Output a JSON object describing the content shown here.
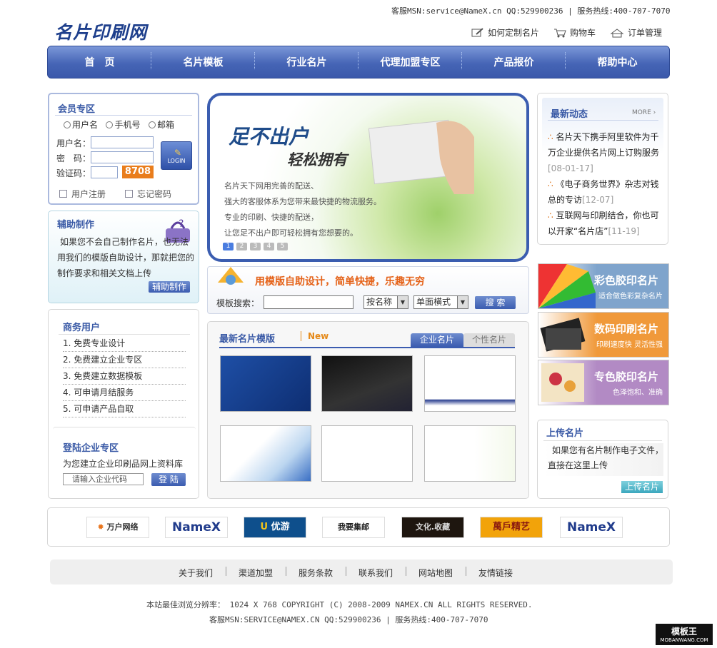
{
  "header": {
    "contact": "客服MSN:service@NameX.cn  QQ:529900236 | 服务热线:400-707-7070",
    "logo": "名片印刷网",
    "links": [
      {
        "label": "如何定制名片",
        "icon": "edit-icon"
      },
      {
        "label": "购物车",
        "icon": "cart-icon"
      },
      {
        "label": "订单管理",
        "icon": "truck-icon"
      }
    ]
  },
  "nav": [
    "首　页",
    "名片模板",
    "行业名片",
    "代理加盟专区",
    "产品报价",
    "帮助中心"
  ],
  "member": {
    "title": "会员专区",
    "radios": [
      "用户名",
      "手机号",
      "邮箱"
    ],
    "fields": [
      "用户名：",
      "密　码：",
      "验证码："
    ],
    "captcha": "8708",
    "login": "LOGIN",
    "register": "用户注册",
    "forgot": "忘记密码"
  },
  "assist": {
    "title": "辅助制作",
    "text": "如果您不会自己制作名片，也无法用我们的模版自助设计，那就把您的制作要求和相关文档上传",
    "button": "辅助制作"
  },
  "business": {
    "title": "商务用户",
    "items": [
      "1. 免费专业设计",
      "2. 免费建立企业专区",
      "3. 免费建立数据模板",
      "4. 可申请月结服务",
      "5. 可申请产品自取"
    ]
  },
  "enterprise": {
    "title": "登陆企业专区",
    "desc": "为您建立企业印刷品网上资料库",
    "placeholder": "请输入企业代码",
    "button": "登 陆"
  },
  "banner": {
    "slogan1": "足不出户",
    "slogan2": "轻松拥有",
    "lines": [
      "名片天下网用完善的配送、",
      "强大的客服体系为您带来最快捷的物流服务。",
      "专业的印刷、快捷的配送，",
      "让您足不出户即可轻松拥有您想要的。"
    ],
    "pages": [
      "1",
      "2",
      "3",
      "4",
      "5"
    ]
  },
  "search": {
    "headline": "用模版自助设计，简单快捷，乐趣无穷",
    "label": "模板搜索：",
    "sort": "按名称",
    "mode": "单面横式",
    "button": "搜 索"
  },
  "templates": {
    "title": "最新名片模版",
    "new_tag": "New",
    "tabs": [
      "企业名片",
      "个性名片"
    ]
  },
  "news": {
    "title": "最新动态",
    "more": "MORE",
    "items": [
      {
        "text": "名片天下携手阿里软件为千万企业提供名片网上订购服务",
        "date": "[08-01-17]"
      },
      {
        "text": "《电子商务世界》杂志对钱总的专访",
        "date": "[12-07]"
      },
      {
        "text": "互联网与印刷结合，你也可以开家“名片店”",
        "date": "[11-19]"
      }
    ]
  },
  "products": [
    {
      "title": "彩色胶印名片",
      "sub": "适合做色彩复杂名片",
      "color": "#7fa4cc"
    },
    {
      "title": "数码印刷名片",
      "sub": "印刷速度快  灵活性强",
      "color": "#f0993a"
    },
    {
      "title": "专色胶印名片",
      "sub": "色泽饱和、准确",
      "color": "#b28ac4"
    }
  ],
  "upload": {
    "title": "上传名片",
    "text": "如果您有名片制作电子文件，直接在这里上传",
    "button": "上传名片"
  },
  "partners": [
    "万户网络",
    "NameX",
    "优游",
    "我要集邮",
    "文化.收藏",
    "萬戶精艺",
    "NameX"
  ],
  "footer": {
    "links": [
      "关于我们",
      "渠道加盟",
      "服务条款",
      "联系我们",
      "网站地图",
      "友情链接"
    ],
    "line1": "本站最佳浏览分辨率： 1024 X 768       COPYRIGHT (C) 2008-2009 NAMEX.CN ALL RIGHTS RESERVED.",
    "line2": "客服MSN:SERVICE@NAMEX.CN  QQ:529900236 | 服务热线:400-707-7070",
    "watermark": "模板王",
    "watermark_sub": "MOBANWANG.COM"
  }
}
